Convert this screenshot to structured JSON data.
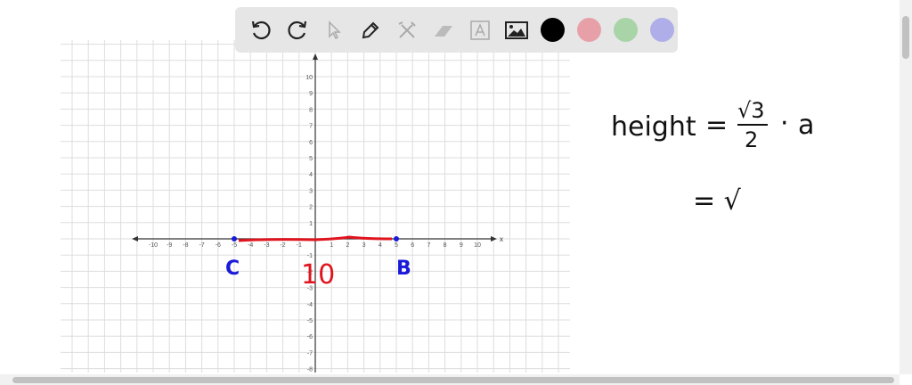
{
  "toolbar": {
    "tools": [
      "undo-icon",
      "redo-icon",
      "select-icon",
      "pen-icon",
      "tools-icon",
      "eraser-icon",
      "text-icon",
      "image-icon"
    ],
    "colors": [
      "#000000",
      "#e8a0a8",
      "#a8d4a8",
      "#b0aee8"
    ]
  },
  "graph": {
    "x_ticks": [
      -10,
      -9,
      -8,
      -7,
      -6,
      -5,
      -4,
      -3,
      -2,
      -1,
      1,
      2,
      3,
      4,
      5,
      6,
      7,
      8,
      9,
      10
    ],
    "y_ticks": [
      10,
      9,
      8,
      7,
      6,
      5,
      4,
      3,
      2,
      1,
      -1,
      -2,
      -3,
      -4,
      -5,
      -6,
      -7,
      -8
    ],
    "x_label": "x",
    "points": [
      {
        "label": "C",
        "x": -5,
        "y": 0
      },
      {
        "label": "B",
        "x": 5,
        "y": 0
      }
    ],
    "segment_label": "10",
    "point_color": "#1a1adb",
    "segment_color": "#e0141e"
  },
  "notes": {
    "line1_lhs": "height",
    "eq": "=",
    "num": "√3",
    "den": "2",
    "dot": "·",
    "var": "a",
    "line2": "= √"
  }
}
